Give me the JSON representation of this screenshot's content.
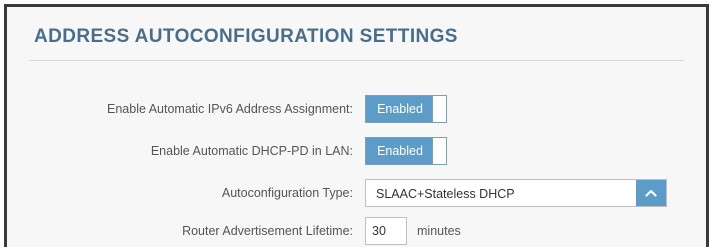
{
  "section": {
    "title": "ADDRESS AUTOCONFIGURATION SETTINGS"
  },
  "fields": {
    "ipv6_assignment": {
      "label": "Enable Automatic IPv6 Address Assignment:",
      "state": "Enabled"
    },
    "dhcp_pd": {
      "label": "Enable Automatic DHCP-PD in LAN:",
      "state": "Enabled"
    },
    "autoconfig_type": {
      "label": "Autoconfiguration Type:",
      "value": "SLAAC+Stateless DHCP"
    },
    "ra_lifetime": {
      "label": "Router Advertisement Lifetime:",
      "value": "30",
      "unit": "minutes"
    }
  },
  "colors": {
    "title": "#4a6e8a",
    "accent": "#5b9cc8",
    "frame": "#3a3a3a"
  },
  "icons": {
    "dropdown": "chevron-up-icon"
  }
}
